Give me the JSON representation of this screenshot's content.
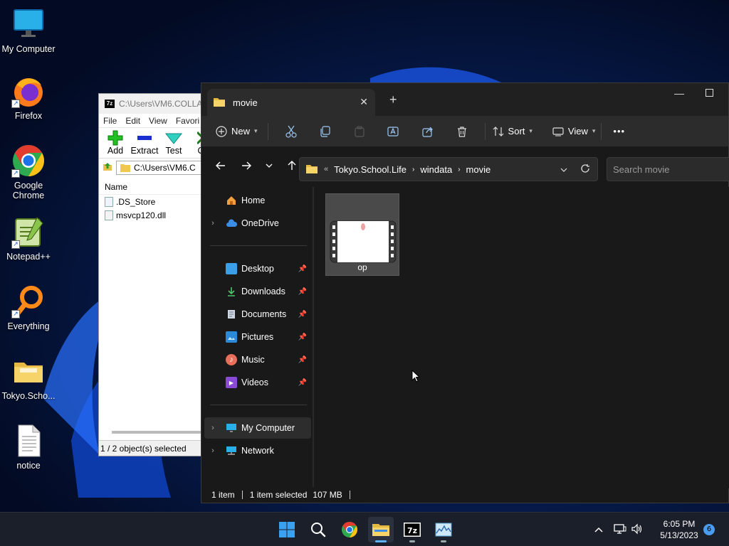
{
  "desktop": {
    "icons": [
      {
        "label": "My Computer"
      },
      {
        "label": "Firefox"
      },
      {
        "label": "Google Chrome"
      },
      {
        "label": "Notepad++"
      },
      {
        "label": "Everything"
      },
      {
        "label": "Tokyo.Scho..."
      },
      {
        "label": "notice"
      }
    ]
  },
  "zip_window": {
    "title": "C:\\Users\\VM6.COLLA",
    "menu": [
      "File",
      "Edit",
      "View",
      "Favori"
    ],
    "toolbar": [
      "Add",
      "Extract",
      "Test",
      "C"
    ],
    "address": "C:\\Users\\VM6.C",
    "column_name": "Name",
    "files": [
      ".DS_Store",
      "msvcp120.dll"
    ],
    "status": "1 / 2 object(s) selected"
  },
  "explorer": {
    "tab_title": "movie",
    "new_tab": "+",
    "cmd": {
      "new_label": "New",
      "sort_label": "Sort",
      "view_label": "View",
      "more": "•••"
    },
    "address": {
      "overflow": "«",
      "crumbs": [
        "Tokyo.School.Life",
        "windata",
        "movie"
      ]
    },
    "search_placeholder": "Search movie",
    "nav": {
      "home": "Home",
      "onedrive": "OneDrive",
      "quick": [
        "Desktop",
        "Downloads",
        "Documents",
        "Pictures",
        "Music",
        "Videos"
      ],
      "my_computer": "My Computer",
      "network": "Network"
    },
    "items": [
      {
        "name": "op"
      }
    ],
    "status": {
      "count": "1 item",
      "selected": "1 item selected",
      "size": "107 MB"
    }
  },
  "taskbar": {
    "time": "6:05 PM",
    "date": "5/13/2023",
    "notifications": "6"
  }
}
